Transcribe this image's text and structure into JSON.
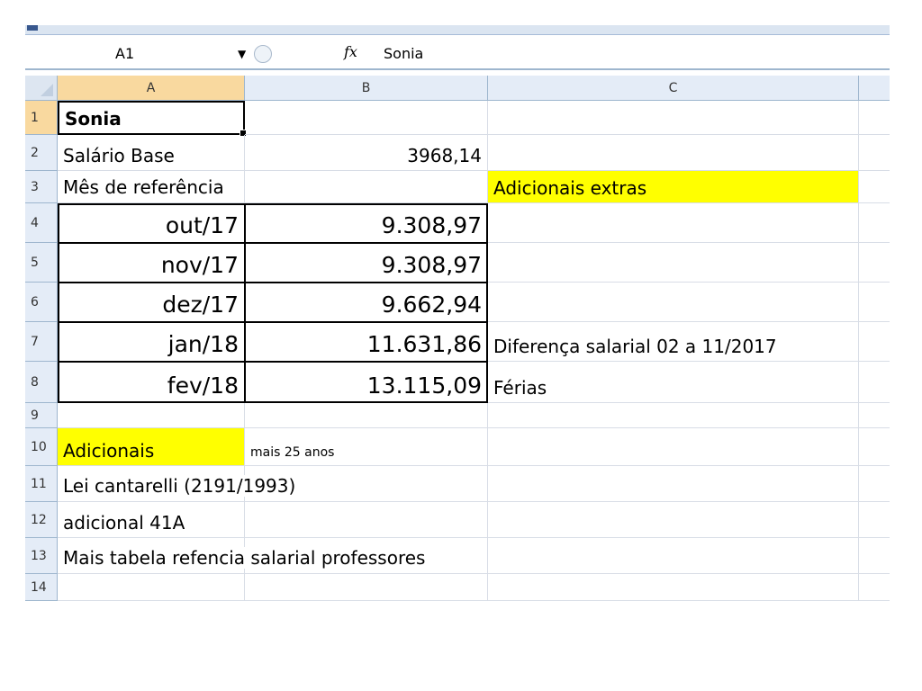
{
  "name_box": {
    "value": "A1"
  },
  "formula_bar": {
    "fx": "fx",
    "content": "Sonia"
  },
  "columns": [
    "A",
    "B",
    "C"
  ],
  "rows": [
    "1",
    "2",
    "3",
    "4",
    "5",
    "6",
    "7",
    "8",
    "9",
    "10",
    "11",
    "12",
    "13",
    "14"
  ],
  "cells": {
    "A1": "Sonia",
    "A2": "Salário Base",
    "B2": "3968,14",
    "A3": "Mês de referência",
    "C3": "Adicionais extras",
    "A4": "out/17",
    "B4": "9.308,97",
    "A5": "nov/17",
    "B5": "9.308,97",
    "A6": "dez/17",
    "B6": "9.662,94",
    "A7": "jan/18",
    "B7": "11.631,86",
    "C7": "Diferença salarial 02 a 11/2017",
    "A8": "fev/18",
    "B8": "13.115,09",
    "C8": "Férias",
    "A10": "Adicionais",
    "B10": "mais 25 anos",
    "A11": "Lei cantarelli (2191/1993)",
    "A12": "adicional 41A",
    "A13": "Mais tabela refencia salarial professores"
  },
  "highlight_color": "#ffff00"
}
